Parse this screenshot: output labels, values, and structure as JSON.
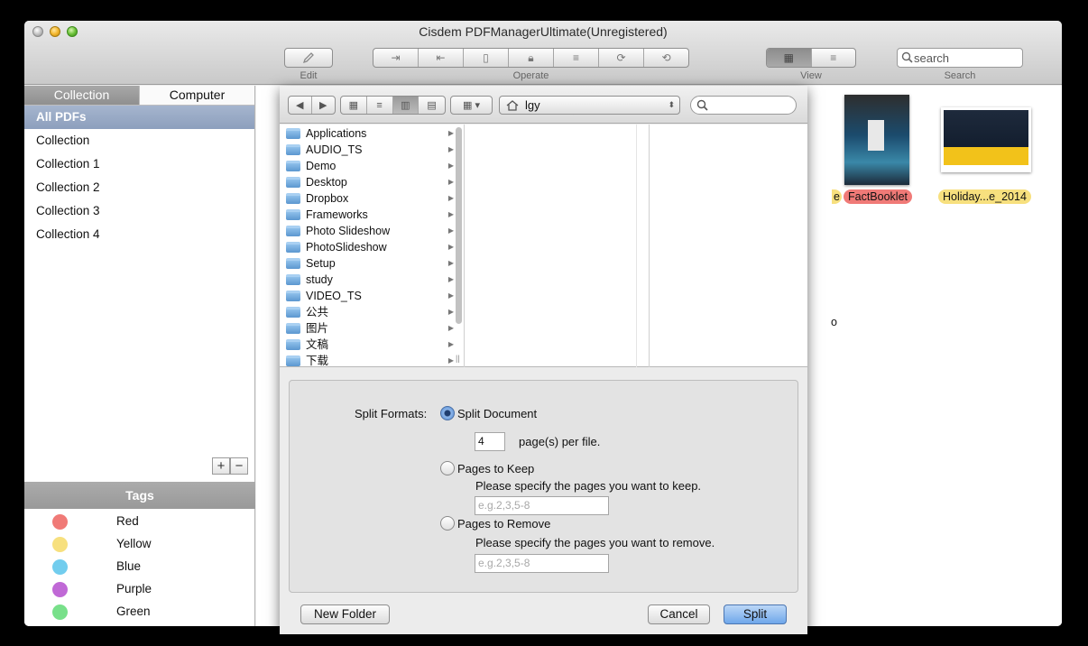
{
  "window": {
    "title": "Cisdem PDFManagerUltimate(Unregistered)"
  },
  "toolbar": {
    "edit_label": "Edit",
    "operate_label": "Operate",
    "view_label": "View",
    "search_label": "Search",
    "search_placeholder": "search"
  },
  "sidebar": {
    "tabs": [
      "Collection",
      "Computer"
    ],
    "items": [
      "All PDFs",
      "Collection",
      "Collection 1",
      "Collection 2",
      "Collection 3",
      "Collection 4"
    ],
    "tags_header": "Tags",
    "tags": [
      {
        "name": "Red",
        "color": "#f07a77"
      },
      {
        "name": "Yellow",
        "color": "#f7e07e"
      },
      {
        "name": "Blue",
        "color": "#72cdee"
      },
      {
        "name": "Purple",
        "color": "#c069d6"
      },
      {
        "name": "Green",
        "color": "#78e08a"
      }
    ],
    "add": "+",
    "remove": "−"
  },
  "main": {
    "thumbnails": [
      {
        "label": "FactBooklet",
        "tag_color": "#f07a77"
      },
      {
        "label": "Holiday...e_2014",
        "tag_color": "#f7e07e"
      }
    ],
    "partial_label_1": "e",
    "partial_label_2": "o"
  },
  "sheet": {
    "path": "lgy",
    "files": [
      {
        "name": "Applications",
        "icon": "applications-folder-icon"
      },
      {
        "name": "AUDIO_TS",
        "icon": "folder-icon"
      },
      {
        "name": "Demo",
        "icon": "folder-icon"
      },
      {
        "name": "Desktop",
        "icon": "folder-icon"
      },
      {
        "name": "Dropbox",
        "icon": "dropbox-folder-icon"
      },
      {
        "name": "Frameworks",
        "icon": "folder-icon"
      },
      {
        "name": "Photo Slideshow",
        "icon": "folder-icon"
      },
      {
        "name": "PhotoSlideshow",
        "icon": "folder-icon"
      },
      {
        "name": "Setup",
        "icon": "folder-icon"
      },
      {
        "name": "study",
        "icon": "folder-icon"
      },
      {
        "name": "VIDEO_TS",
        "icon": "folder-icon"
      },
      {
        "name": "公共",
        "icon": "public-folder-icon"
      },
      {
        "name": "图片",
        "icon": "pictures-folder-icon"
      },
      {
        "name": "文稿",
        "icon": "documents-folder-icon"
      },
      {
        "name": "下载",
        "icon": "downloads-folder-icon"
      }
    ],
    "split_formats_label": "Split Formats:",
    "option_split_document": "Split Document",
    "pages_per_file_value": "4",
    "pages_per_file_label": "page(s) per file.",
    "option_pages_to_keep": "Pages to Keep",
    "keep_help": "Please specify the pages you want to keep.",
    "keep_placeholder": "e.g.2,3,5-8",
    "option_pages_to_remove": "Pages to Remove",
    "remove_help": "Please specify the pages you want to remove.",
    "remove_placeholder": "e.g.2,3,5-8",
    "new_folder": "New Folder",
    "cancel": "Cancel",
    "split": "Split"
  }
}
